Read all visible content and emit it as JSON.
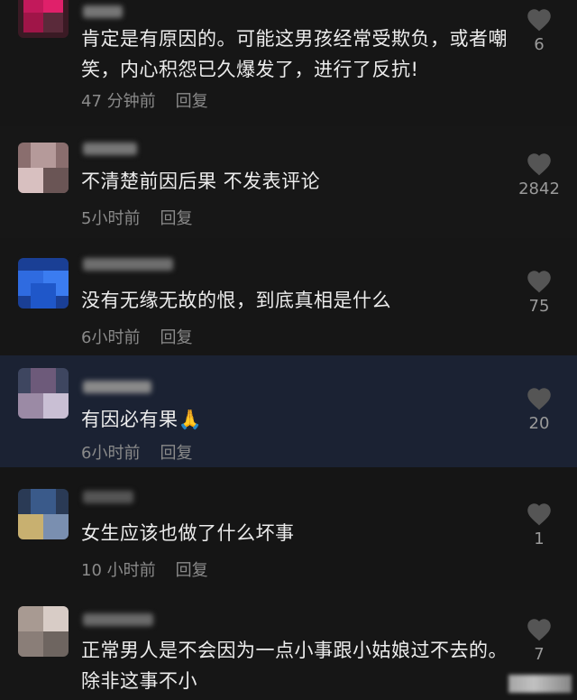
{
  "comments": [
    {
      "text": "肯定是有原因的。可能这男孩经常受欺负，或者嘲笑，内心积怨已久爆发了，进行了反抗!",
      "time": "47 分钟前",
      "reply_label": "回复",
      "likes": "6",
      "avatar_colors": [
        "#7a3a52",
        "#c2195b",
        "#e0206a",
        "#5a2a3a"
      ]
    },
    {
      "text": "不清楚前因后果 不发表评论",
      "time": "5小时前",
      "reply_label": "回复",
      "likes": "2842",
      "avatar_colors": [
        "#8a6e6e",
        "#b59a9a",
        "#d8c0c0",
        "#6a5555"
      ]
    },
    {
      "text": "没有无缘无故的恨，到底真相是什么",
      "time": "6小时前",
      "reply_label": "回复",
      "likes": "75",
      "avatar_colors": [
        "#1f57c9",
        "#2f6be0",
        "#3b7cf0",
        "#1a3f95"
      ]
    },
    {
      "text": "有因必有果🙏",
      "time": "6小时前",
      "reply_label": "回复",
      "likes": "20",
      "avatar_colors": [
        "#6d5a7a",
        "#9b8aa5",
        "#c9bfd4",
        "#3e4660"
      ]
    },
    {
      "text": "女生应该也做了什么坏事",
      "time": "10 小时前",
      "reply_label": "回复",
      "likes": "1",
      "avatar_colors": [
        "#3a5a8a",
        "#c8b070",
        "#7a8fb0",
        "#2a3a55"
      ]
    },
    {
      "text": "正常男人是不会因为一点小事跟小姑娘过不去的。除非这事不小",
      "time": "",
      "reply_label": "",
      "likes": "7",
      "avatar_colors": [
        "#a89a92",
        "#d8ccc6",
        "#8a7e78",
        "#6e6560"
      ]
    }
  ],
  "icons": {
    "like": "heart-icon"
  },
  "colors": {
    "heart": "#4a4a4a"
  }
}
